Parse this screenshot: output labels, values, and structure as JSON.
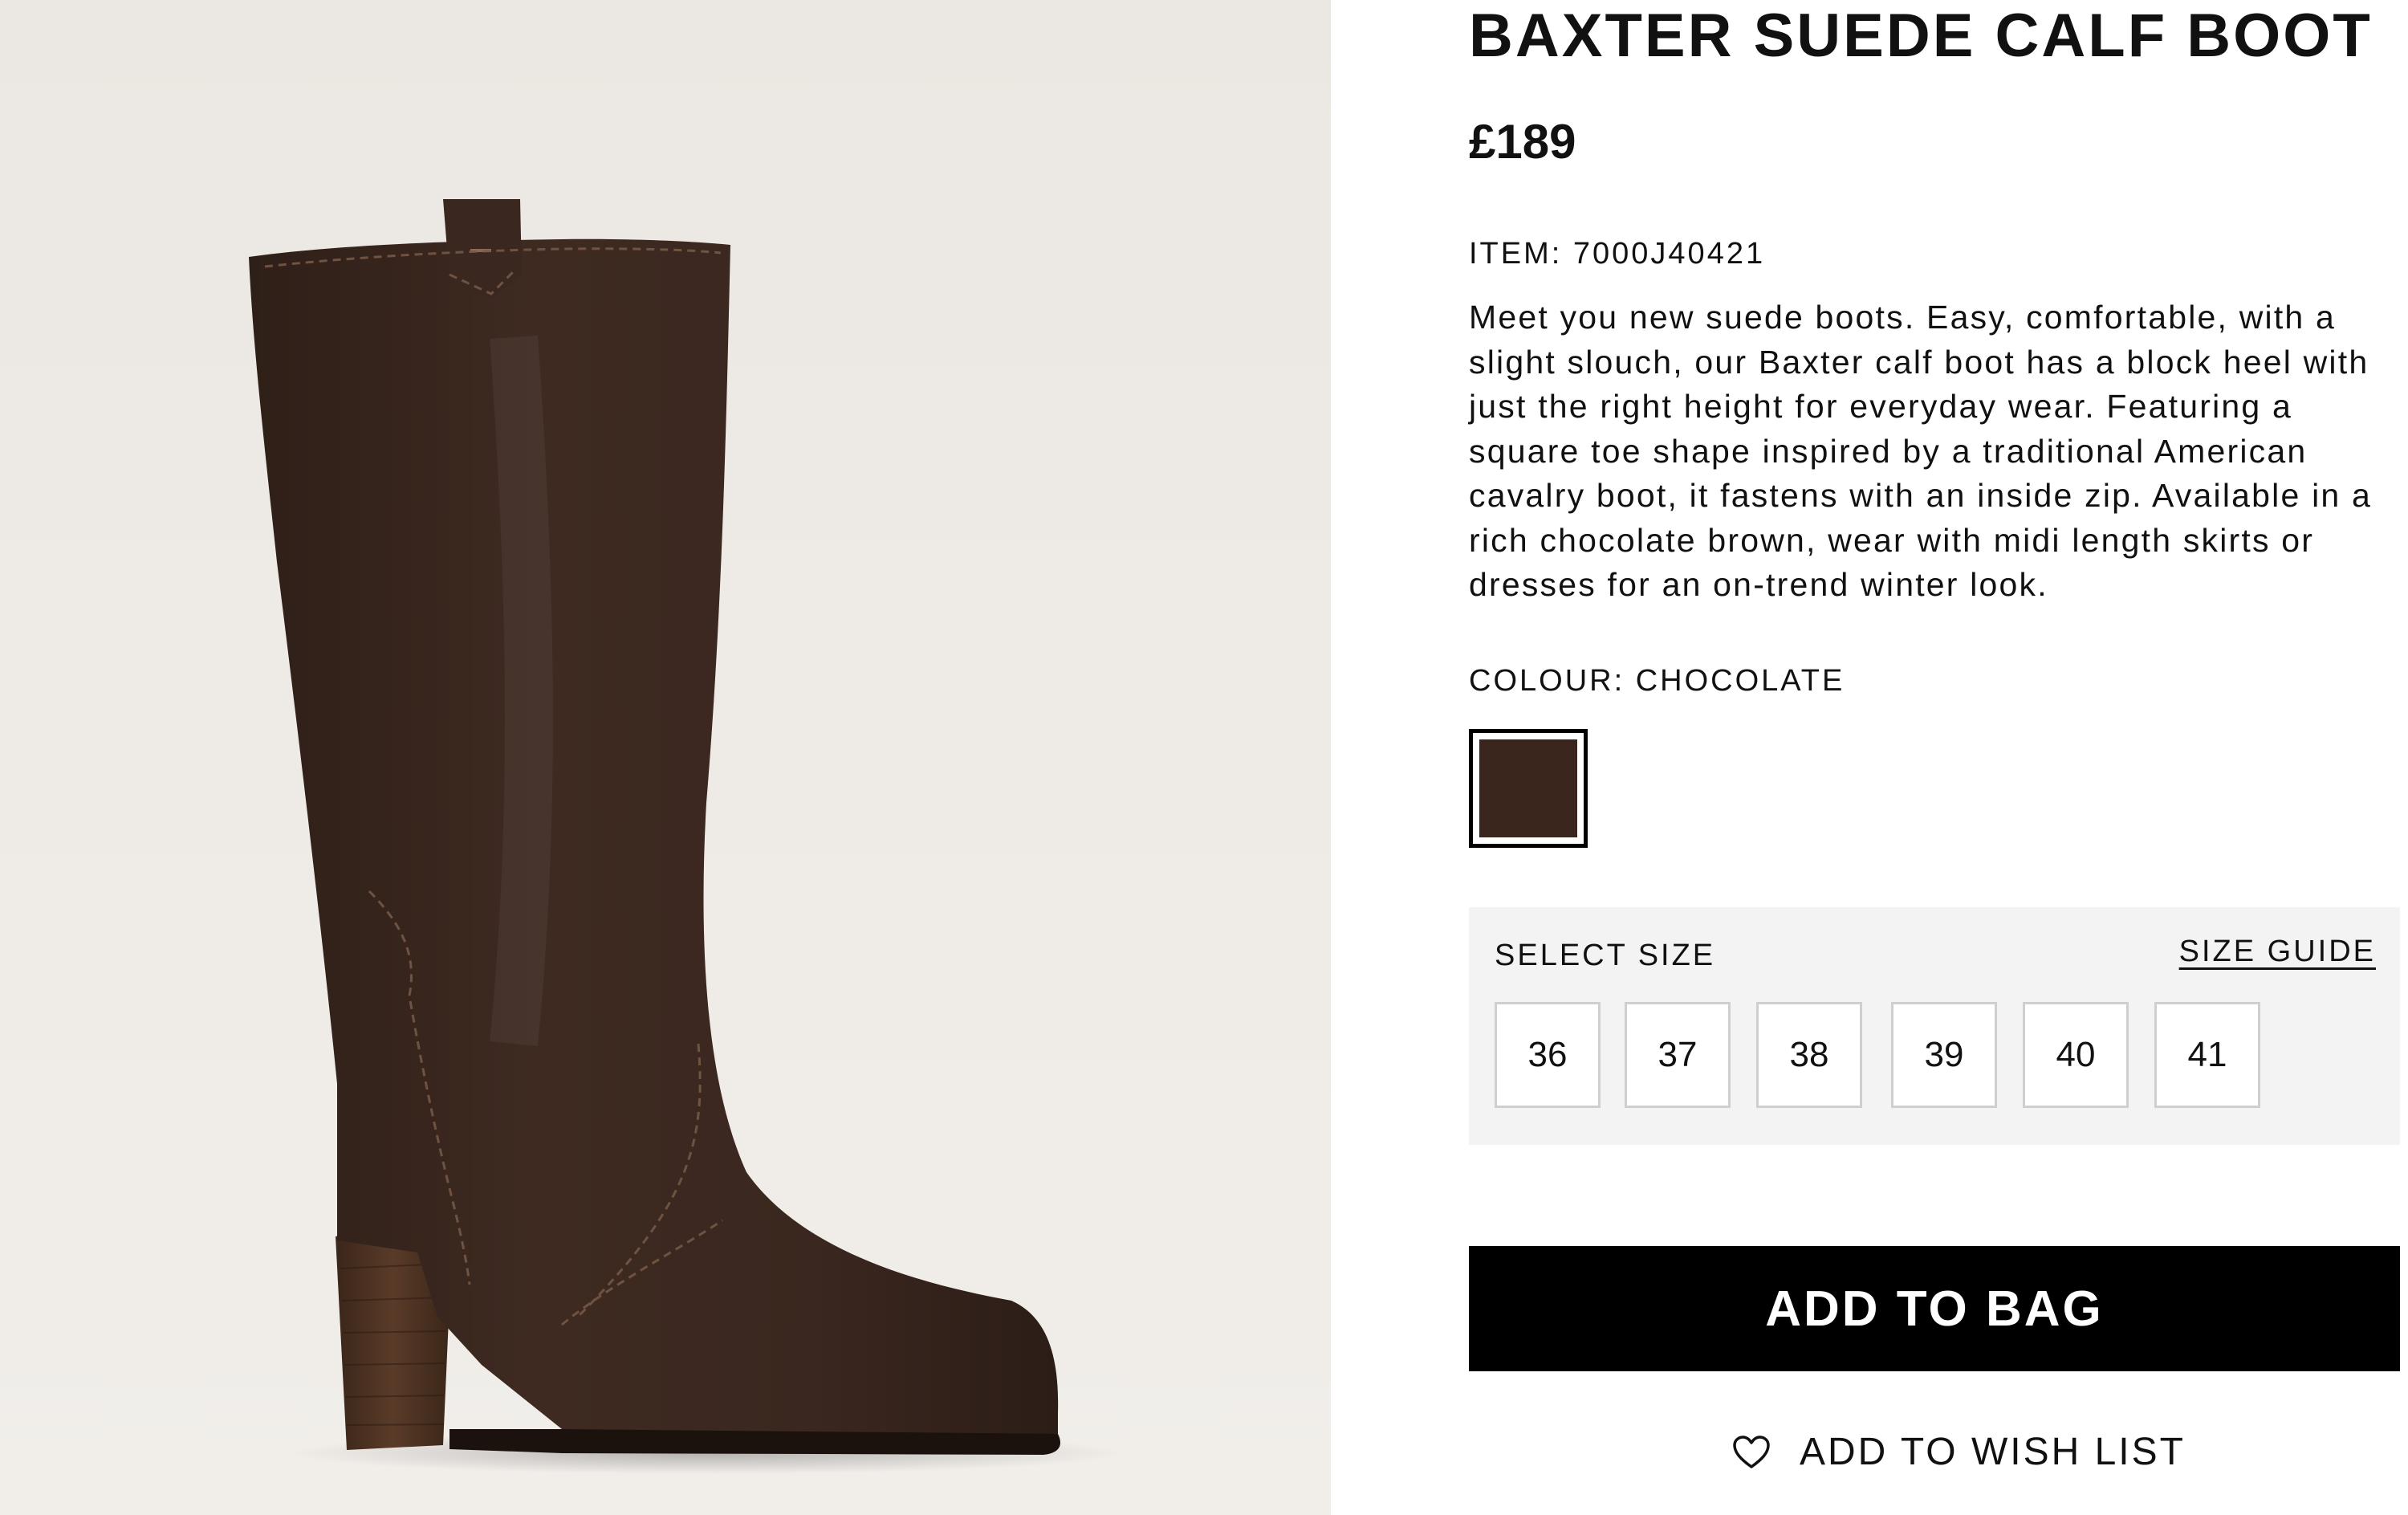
{
  "product": {
    "title": "BAXTER SUEDE CALF BOOT",
    "price": "£189",
    "item_label": "ITEM:",
    "item_code": "7000J40421",
    "description": "Meet you new suede boots. Easy, comfortable, with a slight slouch, our Baxter calf boot has a block heel with just the right height for everyday wear. Featuring a square toe shape inspired by a traditional American cavalry boot, it fastens with an inside zip. Available in a rich chocolate brown, wear with midi length skirts or dresses for an on-trend winter look.",
    "image_icon": "suede-knee-boot-image"
  },
  "colour": {
    "label": "COLOUR: CHOCOLATE",
    "swatch_color": "#3a261d",
    "selected": true
  },
  "sizes": {
    "label": "SELECT SIZE",
    "guide_link": "SIZE GUIDE",
    "options": [
      {
        "label": "36"
      },
      {
        "label": "37"
      },
      {
        "label": "38"
      },
      {
        "label": "39"
      },
      {
        "label": "40"
      },
      {
        "label": "41"
      }
    ]
  },
  "actions": {
    "add_to_bag": "ADD TO BAG",
    "wish_list": "ADD TO WISH LIST",
    "wish_list_icon": "heart-icon"
  },
  "colors": {
    "button_bg": "#000000",
    "size_panel_bg": "#f3f3f3",
    "image_bg": "#ece8e3",
    "boot_color": "#3b2820"
  }
}
